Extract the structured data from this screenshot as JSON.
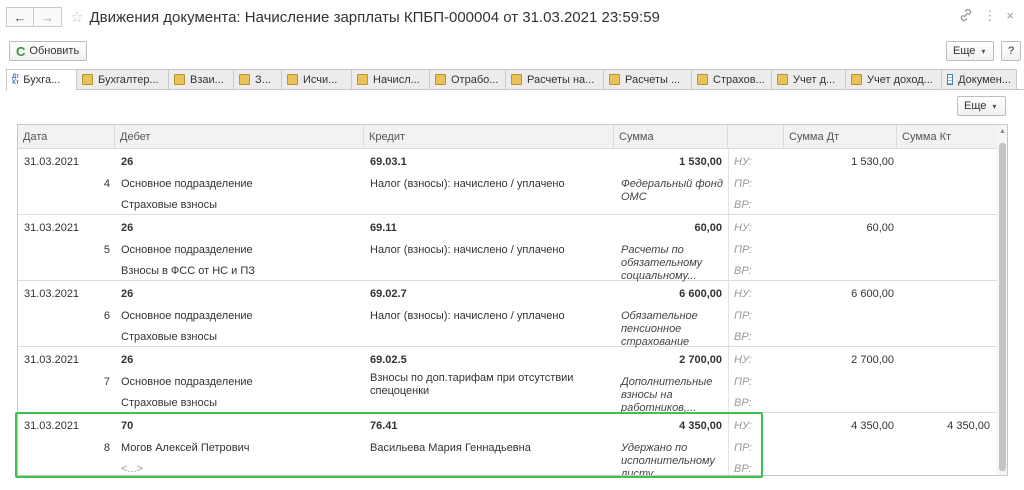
{
  "window": {
    "title": "Движения документа: Начисление зарплаты КПБП-000004 от 31.03.2021 23:59:59",
    "back_glyph": "←",
    "forward_glyph": "→",
    "star_glyph": "☆",
    "link_glyph": "🔗",
    "menu_glyph": "⋮",
    "close_glyph": "×"
  },
  "toolbar": {
    "refresh_label": "Обновить",
    "refresh_glyph": "C",
    "more_label": "Еще",
    "caret": "▾",
    "help_label": "?"
  },
  "tabs": [
    {
      "label": "Бухга...",
      "icon": "dt-kt-icon",
      "active": true
    },
    {
      "label": "Бухгалтер...",
      "icon": "register-icon"
    },
    {
      "label": "Взаи...",
      "icon": "register-icon"
    },
    {
      "label": "З...",
      "icon": "register-icon"
    },
    {
      "label": "Исчи...",
      "icon": "register-icon"
    },
    {
      "label": "Начисл...",
      "icon": "register-icon"
    },
    {
      "label": "Отрабо...",
      "icon": "register-icon"
    },
    {
      "label": "Расчеты на...",
      "icon": "register-icon"
    },
    {
      "label": "Расчеты ...",
      "icon": "register-icon"
    },
    {
      "label": "Страхов...",
      "icon": "register-icon"
    },
    {
      "label": "Учет д...",
      "icon": "register-icon"
    },
    {
      "label": "Учет доход...",
      "icon": "register-icon"
    },
    {
      "label": "Докумен...",
      "icon": "table-icon"
    }
  ],
  "table_toolbar": {
    "more_label": "Еще",
    "caret": "▾"
  },
  "columns": {
    "date": "Дата",
    "debit": "Дебет",
    "credit": "Кредит",
    "sum": "Сумма",
    "sum_dt": "Сумма Дт",
    "sum_kt": "Сумма Кт"
  },
  "account_types": {
    "nu": "НУ:",
    "pr": "ПР:",
    "vr": "ВР:"
  },
  "rows": [
    {
      "date": "31.03.2021",
      "num": "4",
      "debit_account": "26",
      "debit_sub1": "Основное подразделение",
      "debit_sub2": "Страховые взносы",
      "credit_account": "69.03.1",
      "credit_sub1": "Налог (взносы): начислено / уплачено",
      "sum": "1 530,00",
      "sum_note": "Федеральный фонд ОМС",
      "sum_dt": "1 530,00",
      "sum_kt": ""
    },
    {
      "date": "31.03.2021",
      "num": "5",
      "debit_account": "26",
      "debit_sub1": "Основное подразделение",
      "debit_sub2": "Взносы в ФСС от НС и ПЗ",
      "credit_account": "69.11",
      "credit_sub1": "Налог (взносы): начислено / уплачено",
      "sum": "60,00",
      "sum_note": "Расчеты по обязательному социальному...",
      "sum_dt": "60,00",
      "sum_kt": ""
    },
    {
      "date": "31.03.2021",
      "num": "6",
      "debit_account": "26",
      "debit_sub1": "Основное подразделение",
      "debit_sub2": "Страховые взносы",
      "credit_account": "69.02.7",
      "credit_sub1": "Налог (взносы): начислено / уплачено",
      "sum": "6 600,00",
      "sum_note": "Обязательное пенсионное страхование",
      "sum_dt": "6 600,00",
      "sum_kt": ""
    },
    {
      "date": "31.03.2021",
      "num": "7",
      "debit_account": "26",
      "debit_sub1": "Основное подразделение",
      "debit_sub2": "Страховые взносы",
      "credit_account": "69.02.5",
      "credit_sub1": "Взносы по доп.тарифам при отсутствии спецоценки",
      "sum": "2 700,00",
      "sum_note": "Дополнительные взносы на работников,...",
      "sum_dt": "2 700,00",
      "sum_kt": ""
    },
    {
      "date": "31.03.2021",
      "num": "8",
      "debit_account": "70",
      "debit_sub1": "Могов Алексей Петрович",
      "debit_sub2": "<...>",
      "credit_account": "76.41",
      "credit_sub1": "Васильева Мария Геннадьевна",
      "sum": "4 350,00",
      "sum_note": "Удержано по исполнительному листу",
      "sum_dt": "4 350,00",
      "sum_kt": "4 350,00"
    }
  ],
  "colors": {
    "highlight": "#3cc24e",
    "refresh_icon": "#2e9a2e"
  }
}
